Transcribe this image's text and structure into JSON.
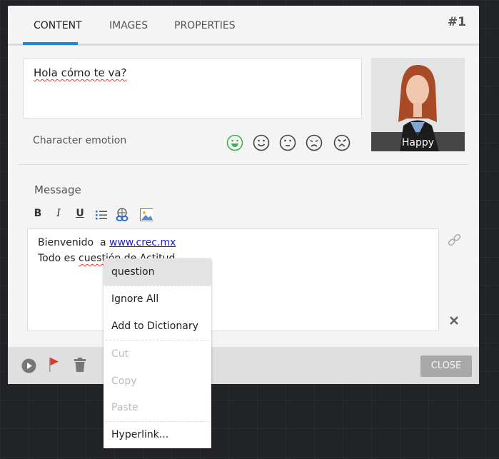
{
  "tabs": [
    {
      "label": "CONTENT",
      "active": true
    },
    {
      "label": "IMAGES"
    },
    {
      "label": "PROPERTIES"
    }
  ],
  "item_number": "#1",
  "dialogue_text": "Hola cómo te va?",
  "emotion": {
    "label": "Character emotion",
    "options": [
      "happy",
      "smile",
      "neutral",
      "sad",
      "angry"
    ],
    "selected": "happy",
    "selected_color": "#3cb54a",
    "caption": "Happy"
  },
  "message": {
    "label": "Message",
    "toolbar": {
      "bold": "B",
      "italic": "I",
      "underline": "U"
    },
    "line1_prefix": "Bienvenido  a ",
    "link": "www.crec.mx",
    "line2_before": "Todo es ",
    "line2_misspelled": "cuestión",
    "line2_after": " de Actitud"
  },
  "footer": {
    "close_label": "CLOSE"
  },
  "context_menu": {
    "items": [
      {
        "label": "question",
        "highlighted": true
      },
      {
        "label": "Ignore All"
      },
      {
        "label": "Add to Dictionary"
      },
      {
        "label": "Cut",
        "disabled": true
      },
      {
        "label": "Copy",
        "disabled": true
      },
      {
        "label": "Paste",
        "disabled": true
      },
      {
        "label": "Hyperlink..."
      }
    ]
  },
  "colors": {
    "accent": "#1c86d8",
    "link": "#1a1adb",
    "flag": "#d93a2b"
  }
}
